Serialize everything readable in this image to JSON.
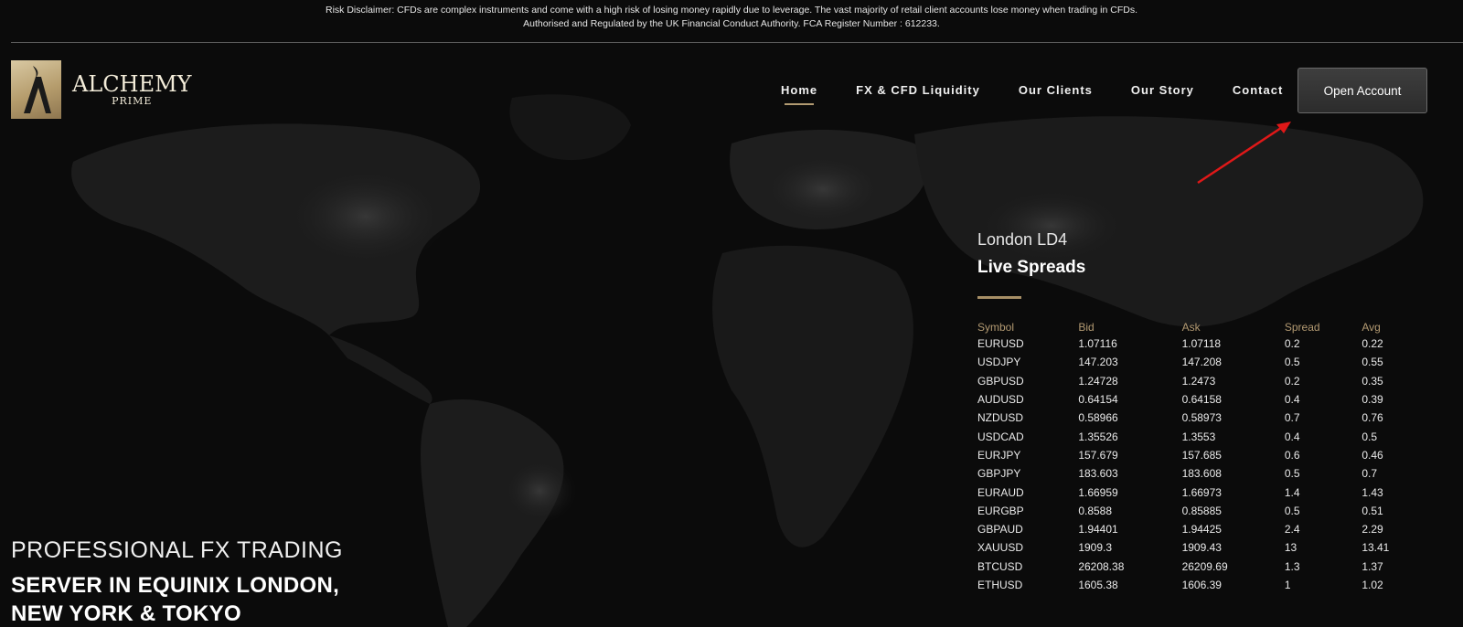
{
  "disclaimer": {
    "line1": "Risk Disclaimer: CFDs are complex instruments and come with a high risk of losing money rapidly due to leverage. The vast majority of retail client accounts lose money when trading in CFDs.",
    "line2": "Authorised and Regulated by the UK Financial Conduct Authority. FCA Register Number : 612233."
  },
  "logo": {
    "name": "ALCHEMY",
    "sub": "PRIME",
    "icon": "alchemy-logo-mark"
  },
  "nav": {
    "items": [
      {
        "label": "Home",
        "active": true
      },
      {
        "label": "FX & CFD Liquidity",
        "active": false
      },
      {
        "label": "Our Clients",
        "active": false
      },
      {
        "label": "Our Story",
        "active": false
      },
      {
        "label": "Contact",
        "active": false
      }
    ],
    "cta_label": "Open Account"
  },
  "spreads": {
    "location": "London LD4",
    "title": "Live Spreads",
    "columns": [
      "Symbol",
      "Bid",
      "Ask",
      "Spread",
      "Avg"
    ],
    "rows": [
      [
        "EURUSD",
        "1.07116",
        "1.07118",
        "0.2",
        "0.22"
      ],
      [
        "USDJPY",
        "147.203",
        "147.208",
        "0.5",
        "0.55"
      ],
      [
        "GBPUSD",
        "1.24728",
        "1.2473",
        "0.2",
        "0.35"
      ],
      [
        "AUDUSD",
        "0.64154",
        "0.64158",
        "0.4",
        "0.39"
      ],
      [
        "NZDUSD",
        "0.58966",
        "0.58973",
        "0.7",
        "0.76"
      ],
      [
        "USDCAD",
        "1.35526",
        "1.3553",
        "0.4",
        "0.5"
      ],
      [
        "EURJPY",
        "157.679",
        "157.685",
        "0.6",
        "0.46"
      ],
      [
        "GBPJPY",
        "183.603",
        "183.608",
        "0.5",
        "0.7"
      ],
      [
        "EURAUD",
        "1.66959",
        "1.66973",
        "1.4",
        "1.43"
      ],
      [
        "EURGBP",
        "0.8588",
        "0.85885",
        "0.5",
        "0.51"
      ],
      [
        "GBPAUD",
        "1.94401",
        "1.94425",
        "2.4",
        "2.29"
      ],
      [
        "XAUUSD",
        "1909.3",
        "1909.43",
        "13",
        "13.41"
      ],
      [
        "BTCUSD",
        "26208.38",
        "26209.69",
        "1.3",
        "1.37"
      ],
      [
        "ETHUSD",
        "1605.38",
        "1606.39",
        "1",
        "1.02"
      ]
    ]
  },
  "hero": {
    "line1": "PROFESSIONAL FX TRADING",
    "line2": "SERVER IN EQUINIX LONDON,",
    "line3": "NEW YORK & TOKYO"
  },
  "colors": {
    "background": "#0b0b0b",
    "accent_gold": "#b29b72",
    "annotation_arrow": "#e01818"
  },
  "icons": {
    "annotation": "red-arrow-icon",
    "background": "world-map-night-lights"
  }
}
